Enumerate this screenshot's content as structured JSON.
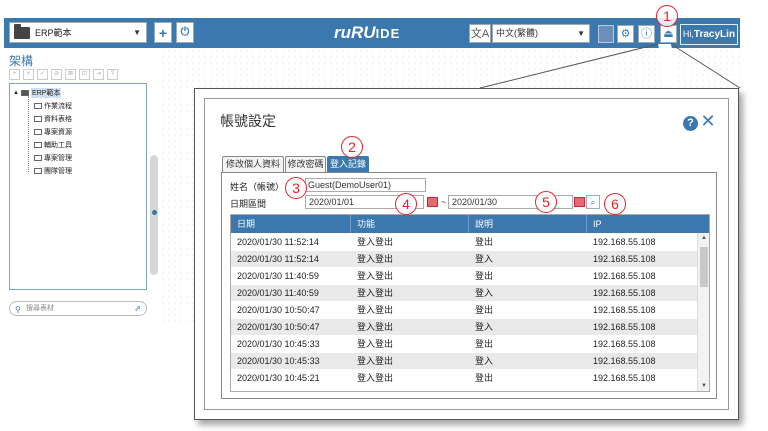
{
  "topbar": {
    "project_select": "ERP範本",
    "add_symbol": "+",
    "power_symbol": "⏻",
    "logo_main": "ruRU",
    "logo_suffix": "IDE",
    "lang_icon": "文A",
    "language": "中文(繁體)",
    "gear_symbol": "⚙",
    "info_symbol": "ⓘ",
    "user_symbol": "⏏",
    "hi_prefix": "Hi,",
    "username": "TracyLin"
  },
  "left_panel": {
    "title": "架構",
    "tools": [
      "+",
      "×",
      "✓",
      "⊘",
      "⊠",
      "⊡",
      "⇥",
      "?"
    ],
    "tree_root": "ERP範本",
    "tree_items": [
      "作業流程",
      "資料表格",
      "專案資源",
      "輔助工具",
      "專案管理",
      "團隊管理"
    ],
    "search_placeholder": "搜尋表材",
    "search_icon": "⚲",
    "ext_icon": "⇗"
  },
  "dialog": {
    "title": "帳號設定",
    "help": "?",
    "close": "✕",
    "tabs": [
      "修改個人資料",
      "修改密碼",
      "登入記錄"
    ],
    "name_label": "姓名（帳號）",
    "name_value": "Guest(DemoUser01)",
    "date_label": "日期區間",
    "date_from": "2020/01/01",
    "tilde": "~",
    "date_to": "2020/01/30",
    "search_symbol": "⌕",
    "columns": [
      "日期",
      "功能",
      "說明",
      "IP"
    ],
    "rows": [
      [
        "2020/01/30 11:52:14",
        "登入登出",
        "登出",
        "192.168.55.108"
      ],
      [
        "2020/01/30 11:52:14",
        "登入登出",
        "登入",
        "192.168.55.108"
      ],
      [
        "2020/01/30 11:40:59",
        "登入登出",
        "登出",
        "192.168.55.108"
      ],
      [
        "2020/01/30 11:40:59",
        "登入登出",
        "登入",
        "192.168.55.108"
      ],
      [
        "2020/01/30 10:50:47",
        "登入登出",
        "登出",
        "192.168.55.108"
      ],
      [
        "2020/01/30 10:50:47",
        "登入登出",
        "登入",
        "192.168.55.108"
      ],
      [
        "2020/01/30 10:45:33",
        "登入登出",
        "登出",
        "192.168.55.108"
      ],
      [
        "2020/01/30 10:45:33",
        "登入登出",
        "登入",
        "192.168.55.108"
      ],
      [
        "2020/01/30 10:45:21",
        "登入登出",
        "登出",
        "192.168.55.108"
      ]
    ]
  },
  "callouts": [
    "1",
    "2",
    "3",
    "4",
    "5",
    "6"
  ],
  "colors": {
    "brand": "#3a78ad",
    "callout": "#e0232a",
    "alt_row": "#e9e9e9"
  }
}
